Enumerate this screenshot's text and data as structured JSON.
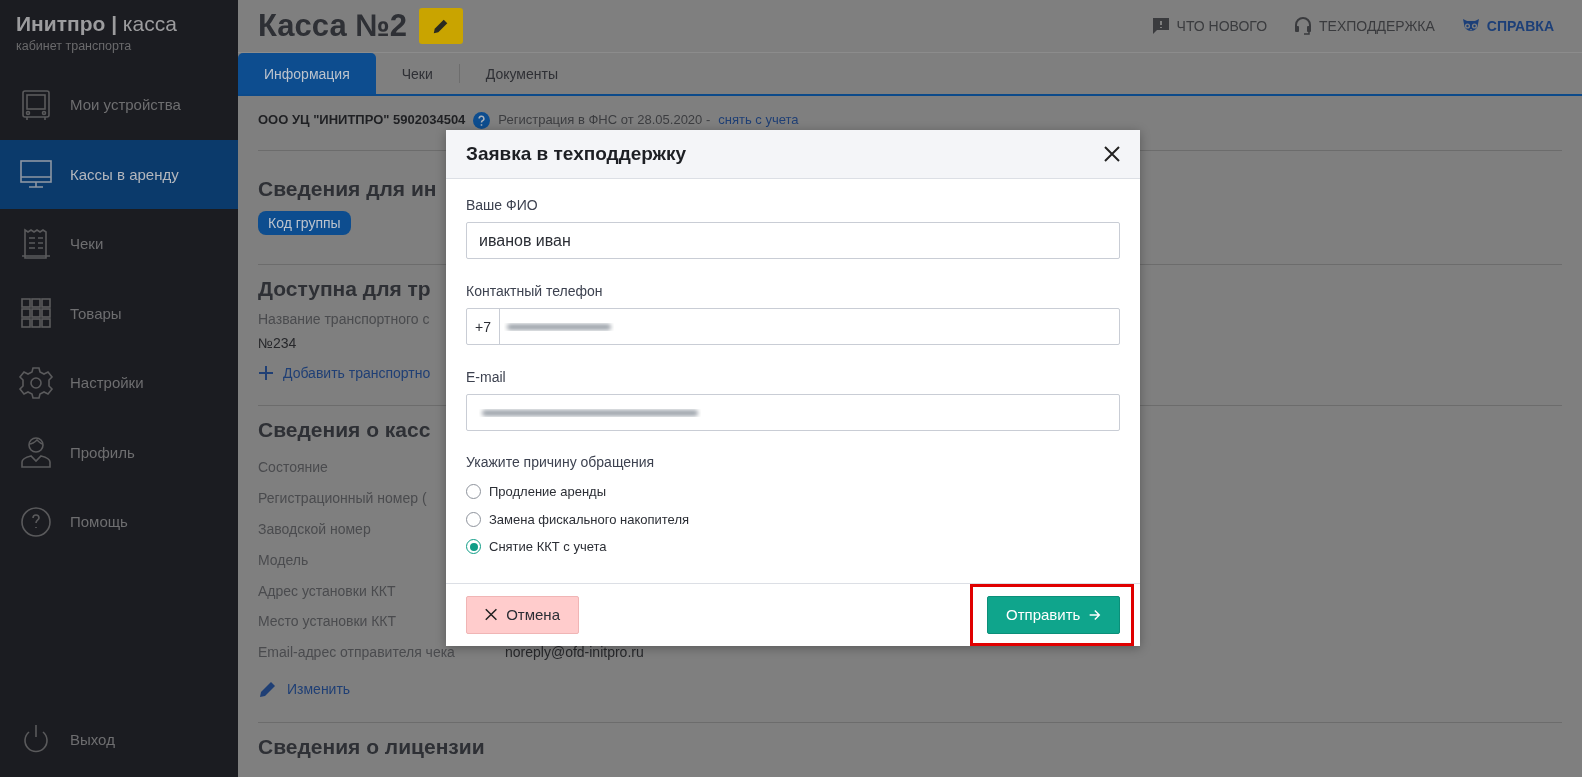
{
  "sidebar": {
    "logo": "**Инитпро |** касса",
    "subtitle": "кабинет транспорта",
    "items": [
      {
        "label": "Мои устройства",
        "selected": false
      },
      {
        "label": "Кассы в аренду",
        "selected": true
      },
      {
        "label": "Чеки",
        "selected": false
      },
      {
        "label": "Товары",
        "selected": false
      },
      {
        "label": "Настройки",
        "selected": false
      },
      {
        "label": "Профиль",
        "selected": false
      },
      {
        "label": "Помощь",
        "selected": false
      }
    ],
    "logout": "Выход"
  },
  "header": {
    "title": "Касса №2",
    "links": [
      {
        "label": "ЧТО НОВОГО",
        "accent": false
      },
      {
        "label": "ТЕХПОДДЕРЖКА",
        "accent": false
      },
      {
        "label": "СПРАВКА",
        "accent": true
      }
    ]
  },
  "tabs": [
    {
      "label": "Информация",
      "selected": true
    },
    {
      "label": "Чеки",
      "selected": false
    },
    {
      "label": "Документы",
      "selected": false
    }
  ],
  "organization": {
    "name": "ООО УЦ \"ИНИТПРО\" 5902034504",
    "registration": "Регистрация в ФНС от 28.05.2020 -",
    "link": "снять с учета"
  },
  "sections": [
    {
      "kind": "tag",
      "title": "Сведения для ин",
      "tag": "Код группы"
    },
    {
      "kind": "vehicles",
      "title": "Доступна для тр",
      "field_label": "Название транспортного с",
      "value": "№234",
      "add_link": "Добавить транспортно"
    },
    {
      "kind": "details",
      "title": "Сведения о касс",
      "rows": [
        {
          "label": "Состояние"
        },
        {
          "label": "Регистрационный номер ("
        },
        {
          "label": "Заводской номер"
        },
        {
          "label": "Модель"
        },
        {
          "label": "Адрес установки ККТ"
        },
        {
          "label": "Место установки ККТ"
        },
        {
          "label": "Email-адрес отправителя чека",
          "value": "noreply@ofd-initpro.ru"
        }
      ],
      "edit_link": "Изменить"
    },
    {
      "kind": "heading",
      "title": "Сведения о лицензии"
    }
  ],
  "dialog": {
    "title": "Заявка в техподдержку",
    "fields": [
      {
        "kind": "text",
        "label": "Ваше ФИО",
        "value": "иванов иван"
      },
      {
        "kind": "phone",
        "label": "Контактный телефон",
        "prefix": "+7"
      },
      {
        "kind": "email",
        "label": "E-mail"
      }
    ],
    "reason_label": "Укажите причину обращения",
    "reasons": [
      {
        "label": "Продление аренды",
        "selected": false
      },
      {
        "label": "Замена фискального накопителя",
        "selected": false
      },
      {
        "label": "Снятие ККТ с учета",
        "selected": true
      }
    ],
    "cancel": "Отмена",
    "submit": "Отправить",
    "submit_highlighted": true
  }
}
